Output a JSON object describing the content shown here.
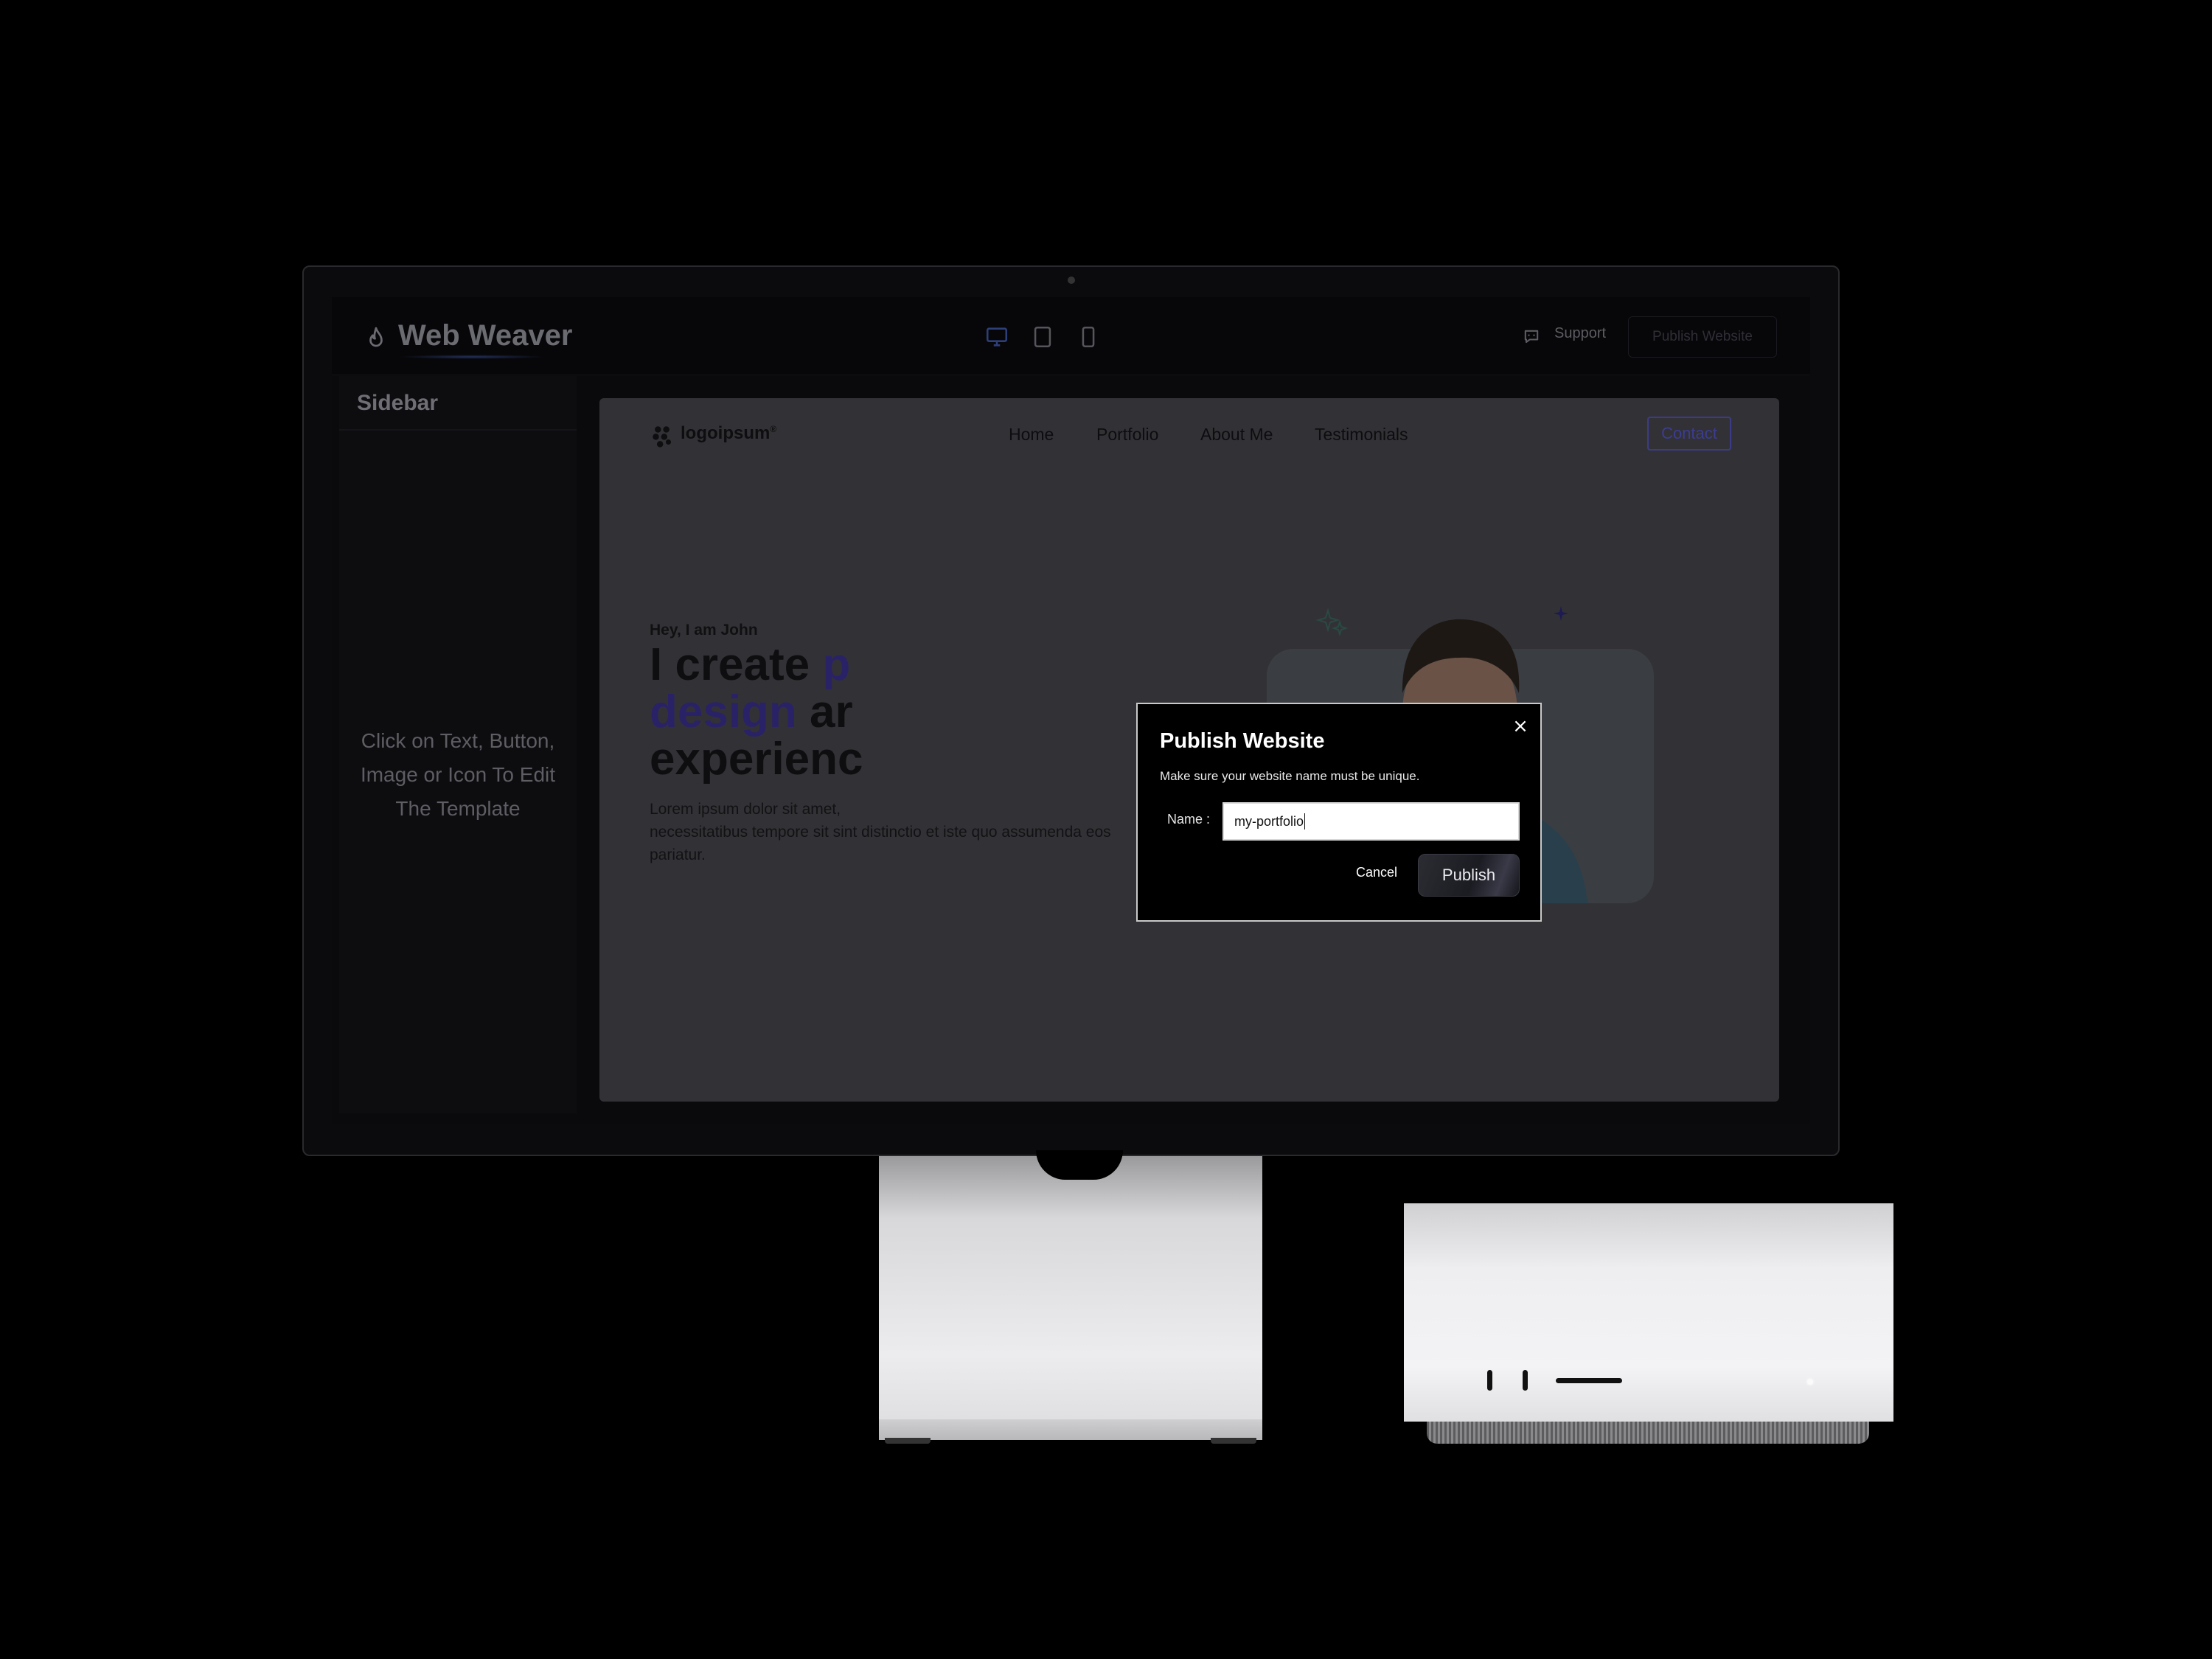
{
  "app": {
    "title": "Web Weaver",
    "support_label": "Support",
    "publish_label": "Publish Website",
    "device_icons": [
      "desktop-icon",
      "tablet-icon",
      "mobile-icon"
    ]
  },
  "sidebar": {
    "title": "Sidebar",
    "hint": "Click on Text, Button, Image or Icon To Edit The Template"
  },
  "template": {
    "logo": "logoipsum",
    "logo_mark": "®",
    "nav": [
      "Home",
      "Portfolio",
      "About Me",
      "Testimonials"
    ],
    "contact": "Contact",
    "greeting": "Hey, I am John",
    "headline": {
      "line1_plain": "I create",
      "line1_accent": "p",
      "line2_accent": "design",
      "line2_plain": "ar",
      "line3_plain": "experienc"
    },
    "description": "Lorem ipsum dolor sit amet,\nnecessitatibus tempore sit sint distinctio et iste quo assumenda eos\npariatur."
  },
  "dialog": {
    "title": "Publish Website",
    "subtitle": "Make sure your website name must be unique.",
    "name_label": "Name :",
    "name_value": "my-portfolio",
    "cancel": "Cancel",
    "publish": "Publish",
    "close_icon": "close-icon"
  },
  "colors": {
    "accent": "#3c3c90",
    "screen_bg": "#0a0a0c",
    "dialog_bg": "#000000"
  }
}
